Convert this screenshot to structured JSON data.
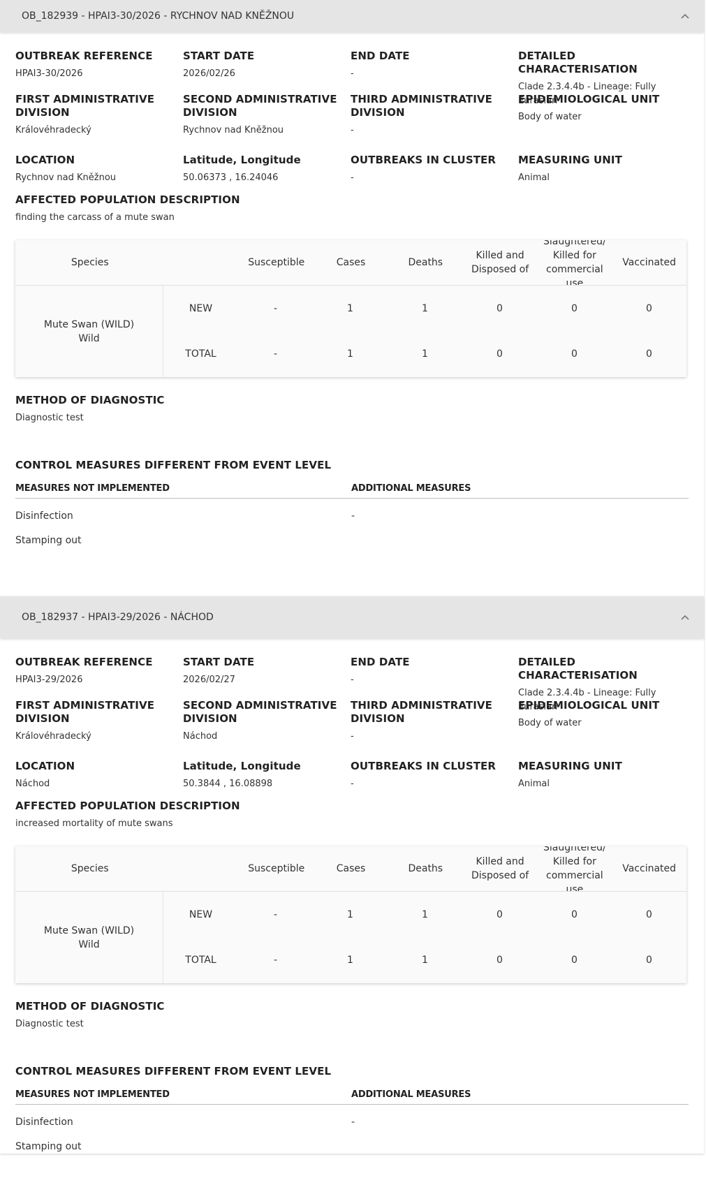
{
  "labels": {
    "outbreak_reference": "OUTBREAK REFERENCE",
    "start_date": "START DATE",
    "end_date": "END DATE",
    "detailed_characterisation": "DETAILED CHARACTERISATION",
    "first_admin": "FIRST ADMINISTRATIVE DIVISION",
    "second_admin": "SECOND ADMINISTRATIVE DIVISION",
    "third_admin": "THIRD ADMINISTRATIVE DIVISION",
    "epi_unit": "EPIDEMIOLOGICAL UNIT",
    "location": "LOCATION",
    "lat_long": "Latitude, Longitude",
    "outbreaks_in_cluster": "OUTBREAKS IN CLUSTER",
    "measuring_unit": "MEASURING UNIT",
    "affected_population": "AFFECTED POPULATION DESCRIPTION",
    "method_of_diagnostic": "METHOD OF DIAGNOSTIC",
    "control_measures": "CONTROL MEASURES DIFFERENT FROM EVENT LEVEL",
    "measures_not_implemented": "MEASURES NOT IMPLEMENTED",
    "additional_measures": "ADDITIONAL MEASURES"
  },
  "table_headers": {
    "species": "Species",
    "susceptible": "Susceptible",
    "cases": "Cases",
    "deaths": "Deaths",
    "killed_disposed": "Killed and Disposed of",
    "slaughtered": "Slaughtered/ Killed for commercial use",
    "vaccinated": "Vaccinated"
  },
  "outbreaks": [
    {
      "header": "OB_182939 - HPAI3-30/2026 - RYCHNOV NAD KNĚŽNOU",
      "outbreak_reference": "HPAI3-30/2026",
      "start_date": "2026/02/26",
      "end_date": "-",
      "detailed_characterisation": "Clade 2.3.4.4b - Lineage: Fully Eurasian",
      "first_admin": "Královéhradecký",
      "second_admin": "Rychnov nad Kněžnou",
      "third_admin": "-",
      "epi_unit": "Body of water",
      "location": "Rychnov nad Kněžnou",
      "lat_long": "50.06373 , 16.24046",
      "outbreaks_in_cluster": "-",
      "measuring_unit": "Animal",
      "affected_population": "finding the carcass of a mute swan",
      "species_name": "Mute Swan (WILD)",
      "species_type": "Wild",
      "rows": [
        {
          "type": "NEW",
          "susceptible": "-",
          "cases": "1",
          "deaths": "1",
          "killed": "0",
          "slaughtered": "0",
          "vaccinated": "0"
        },
        {
          "type": "TOTAL",
          "susceptible": "-",
          "cases": "1",
          "deaths": "1",
          "killed": "0",
          "slaughtered": "0",
          "vaccinated": "0"
        }
      ],
      "diagnostic": "Diagnostic test",
      "measures_not_implemented": [
        "Disinfection",
        "Stamping out"
      ],
      "additional_measures": [
        "-"
      ]
    },
    {
      "header": "OB_182937 - HPAI3-29/2026 - NÁCHOD",
      "outbreak_reference": "HPAI3-29/2026",
      "start_date": "2026/02/27",
      "end_date": "-",
      "detailed_characterisation": "Clade 2.3.4.4b - Lineage: Fully Eurasian",
      "first_admin": "Královéhradecký",
      "second_admin": "Náchod",
      "third_admin": "-",
      "epi_unit": "Body of water",
      "location": "Náchod",
      "lat_long": "50.3844 , 16.08898",
      "outbreaks_in_cluster": "-",
      "measuring_unit": "Animal",
      "affected_population": "increased mortality of mute swans",
      "species_name": "Mute Swan (WILD)",
      "species_type": "Wild",
      "rows": [
        {
          "type": "NEW",
          "susceptible": "-",
          "cases": "1",
          "deaths": "1",
          "killed": "0",
          "slaughtered": "0",
          "vaccinated": "0"
        },
        {
          "type": "TOTAL",
          "susceptible": "-",
          "cases": "1",
          "deaths": "1",
          "killed": "0",
          "slaughtered": "0",
          "vaccinated": "0"
        }
      ],
      "diagnostic": "Diagnostic test",
      "measures_not_implemented": [
        "Disinfection",
        "Stamping out"
      ],
      "additional_measures": [
        "-"
      ]
    }
  ]
}
